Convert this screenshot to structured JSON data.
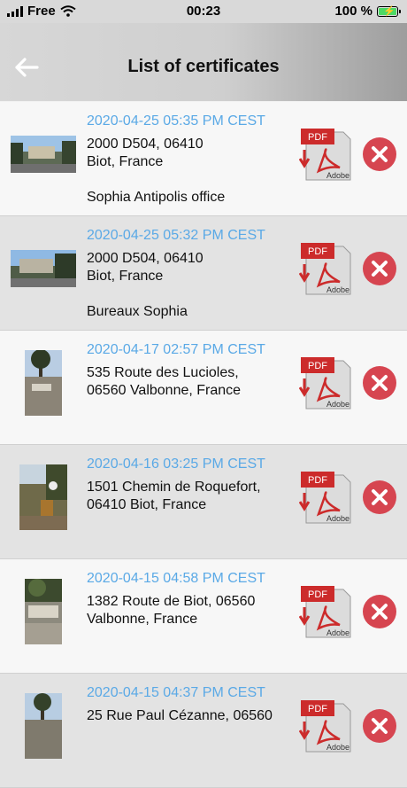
{
  "status": {
    "carrier": "Free",
    "time": "00:23",
    "battery": "100 %",
    "icons": [
      "signal-icon",
      "wifi-icon",
      "battery-charging-icon"
    ]
  },
  "nav": {
    "title": "List of certificates",
    "back_icon": "arrow-left-icon"
  },
  "colors": {
    "date": "#5aa9e6",
    "delete": "#d64550",
    "pdf_red": "#cc2b2b",
    "row_light": "#f7f7f7",
    "row_dark": "#e3e3e3"
  },
  "pdf_icon": {
    "label": "PDF",
    "brand": "Adobe"
  },
  "certificates": [
    {
      "date": "2020-04-25 05:35 PM CEST",
      "address_line1": "2000 D504, 06410",
      "address_line2": "Biot, France",
      "note": "Sophia Antipolis office"
    },
    {
      "date": "2020-04-25 05:32 PM CEST",
      "address_line1": "2000 D504, 06410",
      "address_line2": "Biot, France",
      "note": "Bureaux Sophia"
    },
    {
      "date": "2020-04-17 02:57 PM CEST",
      "address_line1": "535 Route des Lucioles,",
      "address_line2": "06560 Valbonne, France",
      "note": ""
    },
    {
      "date": "2020-04-16 03:25 PM CEST",
      "address_line1": "1501 Chemin de Roquefort,",
      "address_line2": "06410 Biot, France",
      "note": ""
    },
    {
      "date": "2020-04-15 04:58 PM CEST",
      "address_line1": "1382 Route de Biot, 06560",
      "address_line2": "Valbonne, France",
      "note": ""
    },
    {
      "date": "2020-04-15 04:37 PM CEST",
      "address_line1": "25 Rue Paul Cézanne, 06560",
      "address_line2": "",
      "note": ""
    }
  ]
}
